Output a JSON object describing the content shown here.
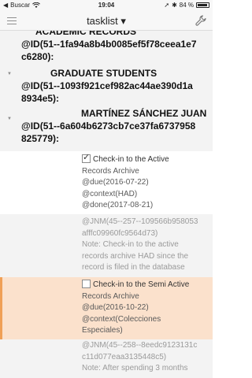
{
  "status_bar": {
    "carrier": "Buscar",
    "time": "19:04",
    "battery": "84 %"
  },
  "nav": {
    "title": "tasklist ▾",
    "menu_icon": "hamburger-icon",
    "settings_icon": "wrench-icon"
  },
  "projects": [
    {
      "title": "ACADEMIC RECORDS",
      "id_lines": [
        "@ID(51--1fa94a8b4b0085ef5f78ceea1e7",
        "c6280):"
      ]
    },
    {
      "title": "GRADUATE STUDENTS",
      "id_lines": [
        "@ID(51--1093f921cef982ac44ae390d1a",
        "8934e5):"
      ]
    },
    {
      "title": "MARTÍNEZ SÁNCHEZ JUAN",
      "id_lines": [
        "@ID(51--6a604b6273cb7ce37fa6737958",
        "825779):"
      ]
    }
  ],
  "tasks": [
    {
      "checked": true,
      "lines": [
        "Check-in to the Active",
        "Records Archive",
        "@due(2016-07-22)",
        "@context(HAD)",
        "@done(2017-08-21)"
      ]
    },
    {
      "note": [
        "@JNM(45--257--109566b958053",
        "afffc09960fc9564d73)",
        "Note: Check-in to the active",
        "records archive HAD since the",
        "record is filed in the database"
      ]
    },
    {
      "checked": false,
      "lines": [
        "Check-in to the Semi Active",
        "Records Archive",
        "@due(2016-10-22)",
        "@context(Colecciones",
        "Especiales)"
      ]
    },
    {
      "note": [
        "@JNM(45--258--8eedc9123131c",
        "c11d077eaa3135448c5)",
        "Note: After spending 3 months"
      ]
    }
  ]
}
